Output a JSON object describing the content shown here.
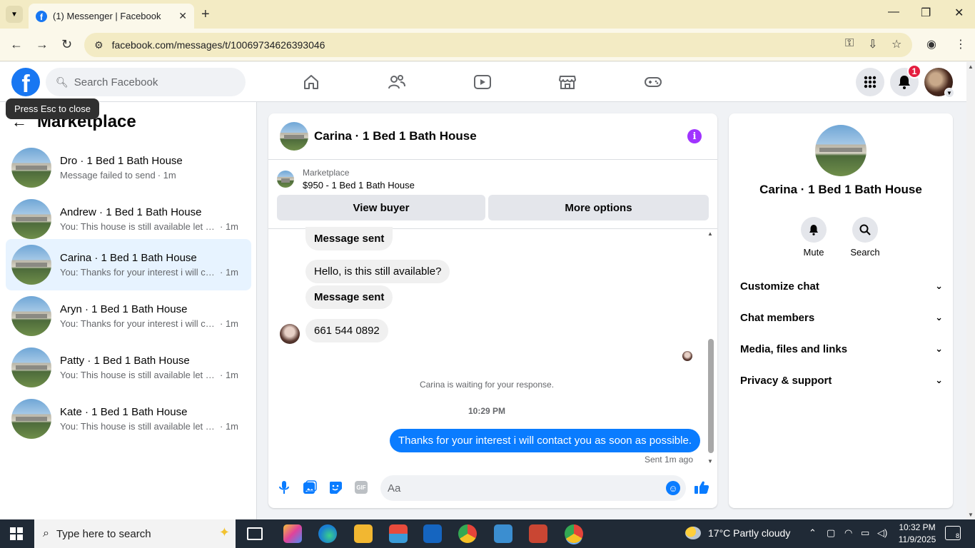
{
  "browser": {
    "tab_title": "(1) Messenger | Facebook",
    "url": "facebook.com/messages/t/10069734626393046"
  },
  "fb": {
    "search_placeholder": "Search Facebook",
    "notification_count": "1",
    "tooltip": "Press Esc to close"
  },
  "sidebar": {
    "title": "Marketplace",
    "conversations": [
      {
        "name": "Dro · 1 Bed 1 Bath House",
        "preview": "Message failed to send",
        "time": "· 1m"
      },
      {
        "name": "Andrew · 1 Bed 1 Bath House",
        "preview": "You: This house is still available let m...",
        "time": "· 1m"
      },
      {
        "name": "Carina · 1 Bed 1 Bath House",
        "preview": "You: Thanks for your interest i will co...",
        "time": "· 1m"
      },
      {
        "name": "Aryn · 1 Bed 1 Bath House",
        "preview": "You: Thanks for your interest i will co...",
        "time": "· 1m"
      },
      {
        "name": "Patty · 1 Bed 1 Bath House",
        "preview": "You: This house is still available let m...",
        "time": "· 1m"
      },
      {
        "name": "Kate · 1 Bed 1 Bath House",
        "preview": "You: This house is still available let m...",
        "time": "· 1m"
      }
    ]
  },
  "chat": {
    "title": "Carina · 1 Bed 1 Bath House",
    "listing_label": "Marketplace",
    "listing_price": "$950 - 1 Bed 1 Bath House",
    "view_buyer": "View buyer",
    "more_options": "More options",
    "messages": [
      {
        "text": "Message sent"
      },
      {
        "text": "Hello, is this still available?"
      },
      {
        "text": "Message sent"
      },
      {
        "text": "661 544 0892"
      }
    ],
    "waiting_note": "Carina is waiting for your response.",
    "time_divider": "10:29 PM",
    "my_message": "Thanks for your interest i will contact you as soon as possible.",
    "sent_status": "Sent 1m ago",
    "composer_placeholder": "Aa"
  },
  "info": {
    "name": "Carina · 1 Bed 1 Bath House",
    "mute_label": "Mute",
    "search_label": "Search",
    "sections": [
      "Customize chat",
      "Chat members",
      "Media, files and links",
      "Privacy & support"
    ]
  },
  "taskbar": {
    "search_placeholder": "Type here to search",
    "weather": "17°C  Partly cloudy",
    "time": "10:32 PM",
    "date": "11/9/2025",
    "notif_count": "8"
  }
}
